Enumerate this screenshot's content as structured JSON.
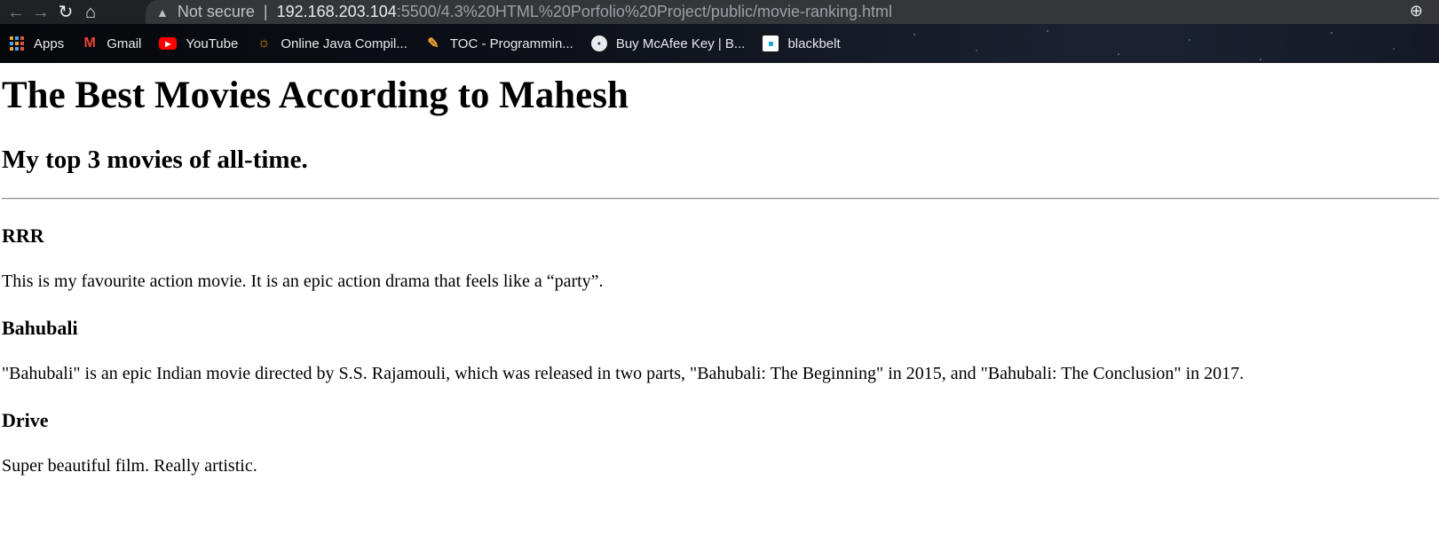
{
  "browser": {
    "url_security": "Not secure",
    "url_host": "192.168.203.104",
    "url_path": ":5500/4.3%20HTML%20Porfolio%20Project/public/movie-ranking.html",
    "bookmarks": [
      {
        "label": "Apps",
        "icon": "apps-grid-icon"
      },
      {
        "label": "Gmail",
        "icon": "gmail-icon"
      },
      {
        "label": "YouTube",
        "icon": "youtube-icon"
      },
      {
        "label": "Online Java Compil...",
        "icon": "java-compiler-icon"
      },
      {
        "label": "TOC - Programmin...",
        "icon": "toc-icon"
      },
      {
        "label": "Buy McAfee Key | B...",
        "icon": "mcafee-icon"
      },
      {
        "label": "blackbelt",
        "icon": "cisco-icon"
      }
    ]
  },
  "page": {
    "title": "The Best Movies According to Mahesh",
    "subtitle": "My top 3 movies of all-time.",
    "movies": [
      {
        "title": "RRR",
        "description": "This is my favourite action movie. It is an epic action drama that feels like a “party”."
      },
      {
        "title": "Bahubali",
        "description": "\"Bahubali\" is an epic Indian movie directed by S.S. Rajamouli, which was released in two parts, \"Bahubali: The Beginning\" in 2015, and \"Bahubali: The Conclusion\" in 2017."
      },
      {
        "title": "Drive",
        "description": "Super beautiful film. Really artistic."
      }
    ]
  }
}
